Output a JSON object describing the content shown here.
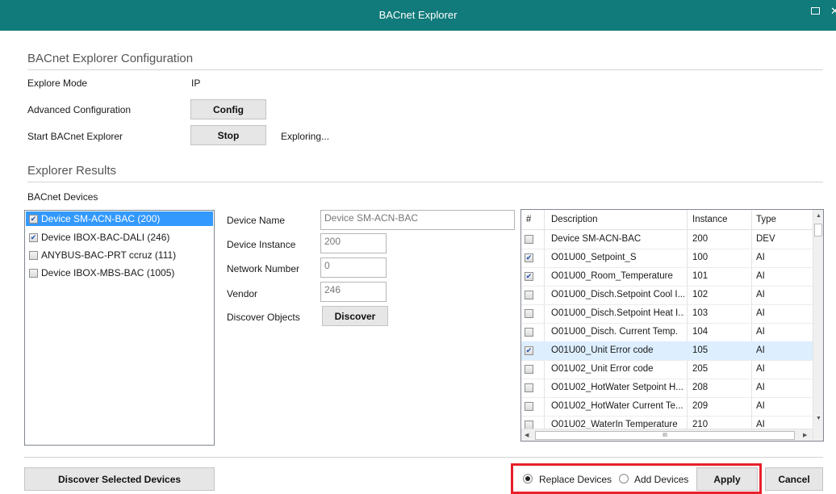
{
  "window": {
    "title": "BACnet Explorer"
  },
  "config": {
    "section_title": "BACnet Explorer Configuration",
    "explore_mode_label": "Explore Mode",
    "explore_mode_value": "IP",
    "advanced_label": "Advanced Configuration",
    "config_button": "Config",
    "start_label": "Start BACnet Explorer",
    "stop_button": "Stop",
    "status_text": "Exploring..."
  },
  "results": {
    "section_title": "Explorer Results",
    "devices_label": "BACnet Devices",
    "devices": [
      {
        "label": "Device SM-ACN-BAC (200)",
        "checked": true,
        "selected": true
      },
      {
        "label": "Device IBOX-BAC-DALI (246)",
        "checked": true,
        "selected": false
      },
      {
        "label": "ANYBUS-BAC-PRT ccruz (111)",
        "checked": false,
        "selected": false
      },
      {
        "label": "Device IBOX-MBS-BAC (1005)",
        "checked": false,
        "selected": false
      }
    ]
  },
  "details": {
    "device_name_label": "Device Name",
    "device_name_value": "Device SM-ACN-BAC",
    "device_instance_label": "Device Instance",
    "device_instance_value": "200",
    "network_number_label": "Network Number",
    "network_number_value": "0",
    "vendor_label": "Vendor",
    "vendor_value": "246",
    "discover_objects_label": "Discover Objects",
    "discover_button": "Discover"
  },
  "objects": {
    "columns": [
      "#",
      "Description",
      "Instance",
      "Type"
    ],
    "rows": [
      {
        "checked": false,
        "description": "Device SM-ACN-BAC",
        "instance": "200",
        "type": "DEV"
      },
      {
        "checked": true,
        "description": "O01U00_Setpoint_S",
        "instance": "100",
        "type": "AI"
      },
      {
        "checked": true,
        "description": "O01U00_Room_Temperature",
        "instance": "101",
        "type": "AI"
      },
      {
        "checked": false,
        "description": "O01U00_Disch.Setpoint Cool I...",
        "instance": "102",
        "type": "AI"
      },
      {
        "checked": false,
        "description": "O01U00_Disch.Setpoint Heat I...",
        "instance": "103",
        "type": "AI"
      },
      {
        "checked": false,
        "description": "O01U00_Disch. Current Temp.",
        "instance": "104",
        "type": "AI"
      },
      {
        "checked": true,
        "description": "O01U00_Unit Error code",
        "instance": "105",
        "type": "AI",
        "highlight": true
      },
      {
        "checked": false,
        "description": "O01U02_Unit Error code",
        "instance": "205",
        "type": "AI"
      },
      {
        "checked": false,
        "description": "O01U02_HotWater Setpoint H...",
        "instance": "208",
        "type": "AI"
      },
      {
        "checked": false,
        "description": "O01U02_HotWater Current Te...",
        "instance": "209",
        "type": "AI"
      },
      {
        "checked": false,
        "description": "O01U02_WaterIn Temperature",
        "instance": "210",
        "type": "AI"
      }
    ],
    "hscroll_grip": "III"
  },
  "footer": {
    "discover_selected_button": "Discover Selected Devices",
    "replace_label": "Replace Devices",
    "add_label": "Add Devices",
    "selected_mode": "replace",
    "apply_button": "Apply",
    "cancel_button": "Cancel"
  }
}
